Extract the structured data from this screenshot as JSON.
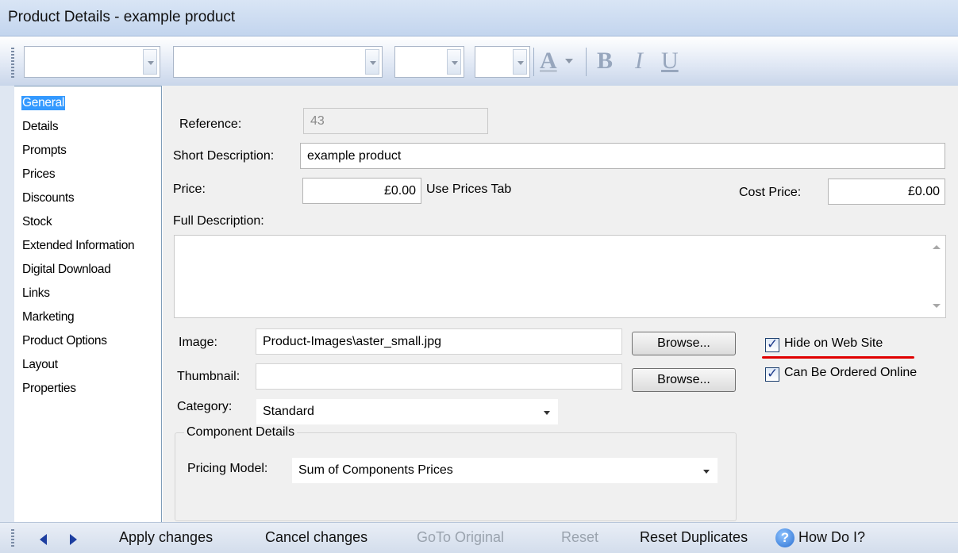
{
  "window": {
    "title": "Product Details - example product"
  },
  "toolbar": {
    "font_color_icon": "A",
    "bold_icon": "B",
    "italic_icon": "I",
    "underline_icon": "U"
  },
  "sidebar": {
    "items": [
      {
        "label": "General",
        "selected": true
      },
      {
        "label": "Details"
      },
      {
        "label": "Prompts"
      },
      {
        "label": "Prices"
      },
      {
        "label": "Discounts"
      },
      {
        "label": "Stock"
      },
      {
        "label": "Extended Information"
      },
      {
        "label": "Digital Download"
      },
      {
        "label": "Links"
      },
      {
        "label": "Marketing"
      },
      {
        "label": "Product Options"
      },
      {
        "label": "Layout"
      },
      {
        "label": "Properties"
      }
    ]
  },
  "form": {
    "reference_label": "Reference:",
    "reference_value": "43",
    "short_description_label": "Short Description:",
    "short_description_value": "example product",
    "price_label": "Price:",
    "price_value": "£0.00",
    "use_prices_tab_label": "Use Prices Tab",
    "cost_price_label": "Cost Price:",
    "cost_price_value": "£0.00",
    "full_description_label": "Full Description:",
    "full_description_value": "",
    "image_label": "Image:",
    "image_value": "Product-Images\\aster_small.jpg",
    "thumbnail_label": "Thumbnail:",
    "thumbnail_value": "",
    "browse_label": "Browse...",
    "hide_on_web_site_label": "Hide on Web Site",
    "hide_on_web_site_checked": true,
    "can_be_ordered_label": "Can Be Ordered Online",
    "can_be_ordered_checked": true,
    "category_label": "Category:",
    "category_value": "Standard",
    "component_details_label": "Component Details",
    "pricing_model_label": "Pricing Model:",
    "pricing_model_value": "Sum of Components Prices"
  },
  "statusbar": {
    "apply_changes": "Apply changes",
    "cancel_changes": "Cancel changes",
    "goto_original": "GoTo Original",
    "reset": "Reset",
    "reset_duplicates": "Reset Duplicates",
    "how_do_i": "How Do I?",
    "help_icon": "?"
  },
  "colors": {
    "selection": "#3399ff",
    "annotation_underline": "#e00000",
    "nav_arrow": "#1d3ea0"
  }
}
